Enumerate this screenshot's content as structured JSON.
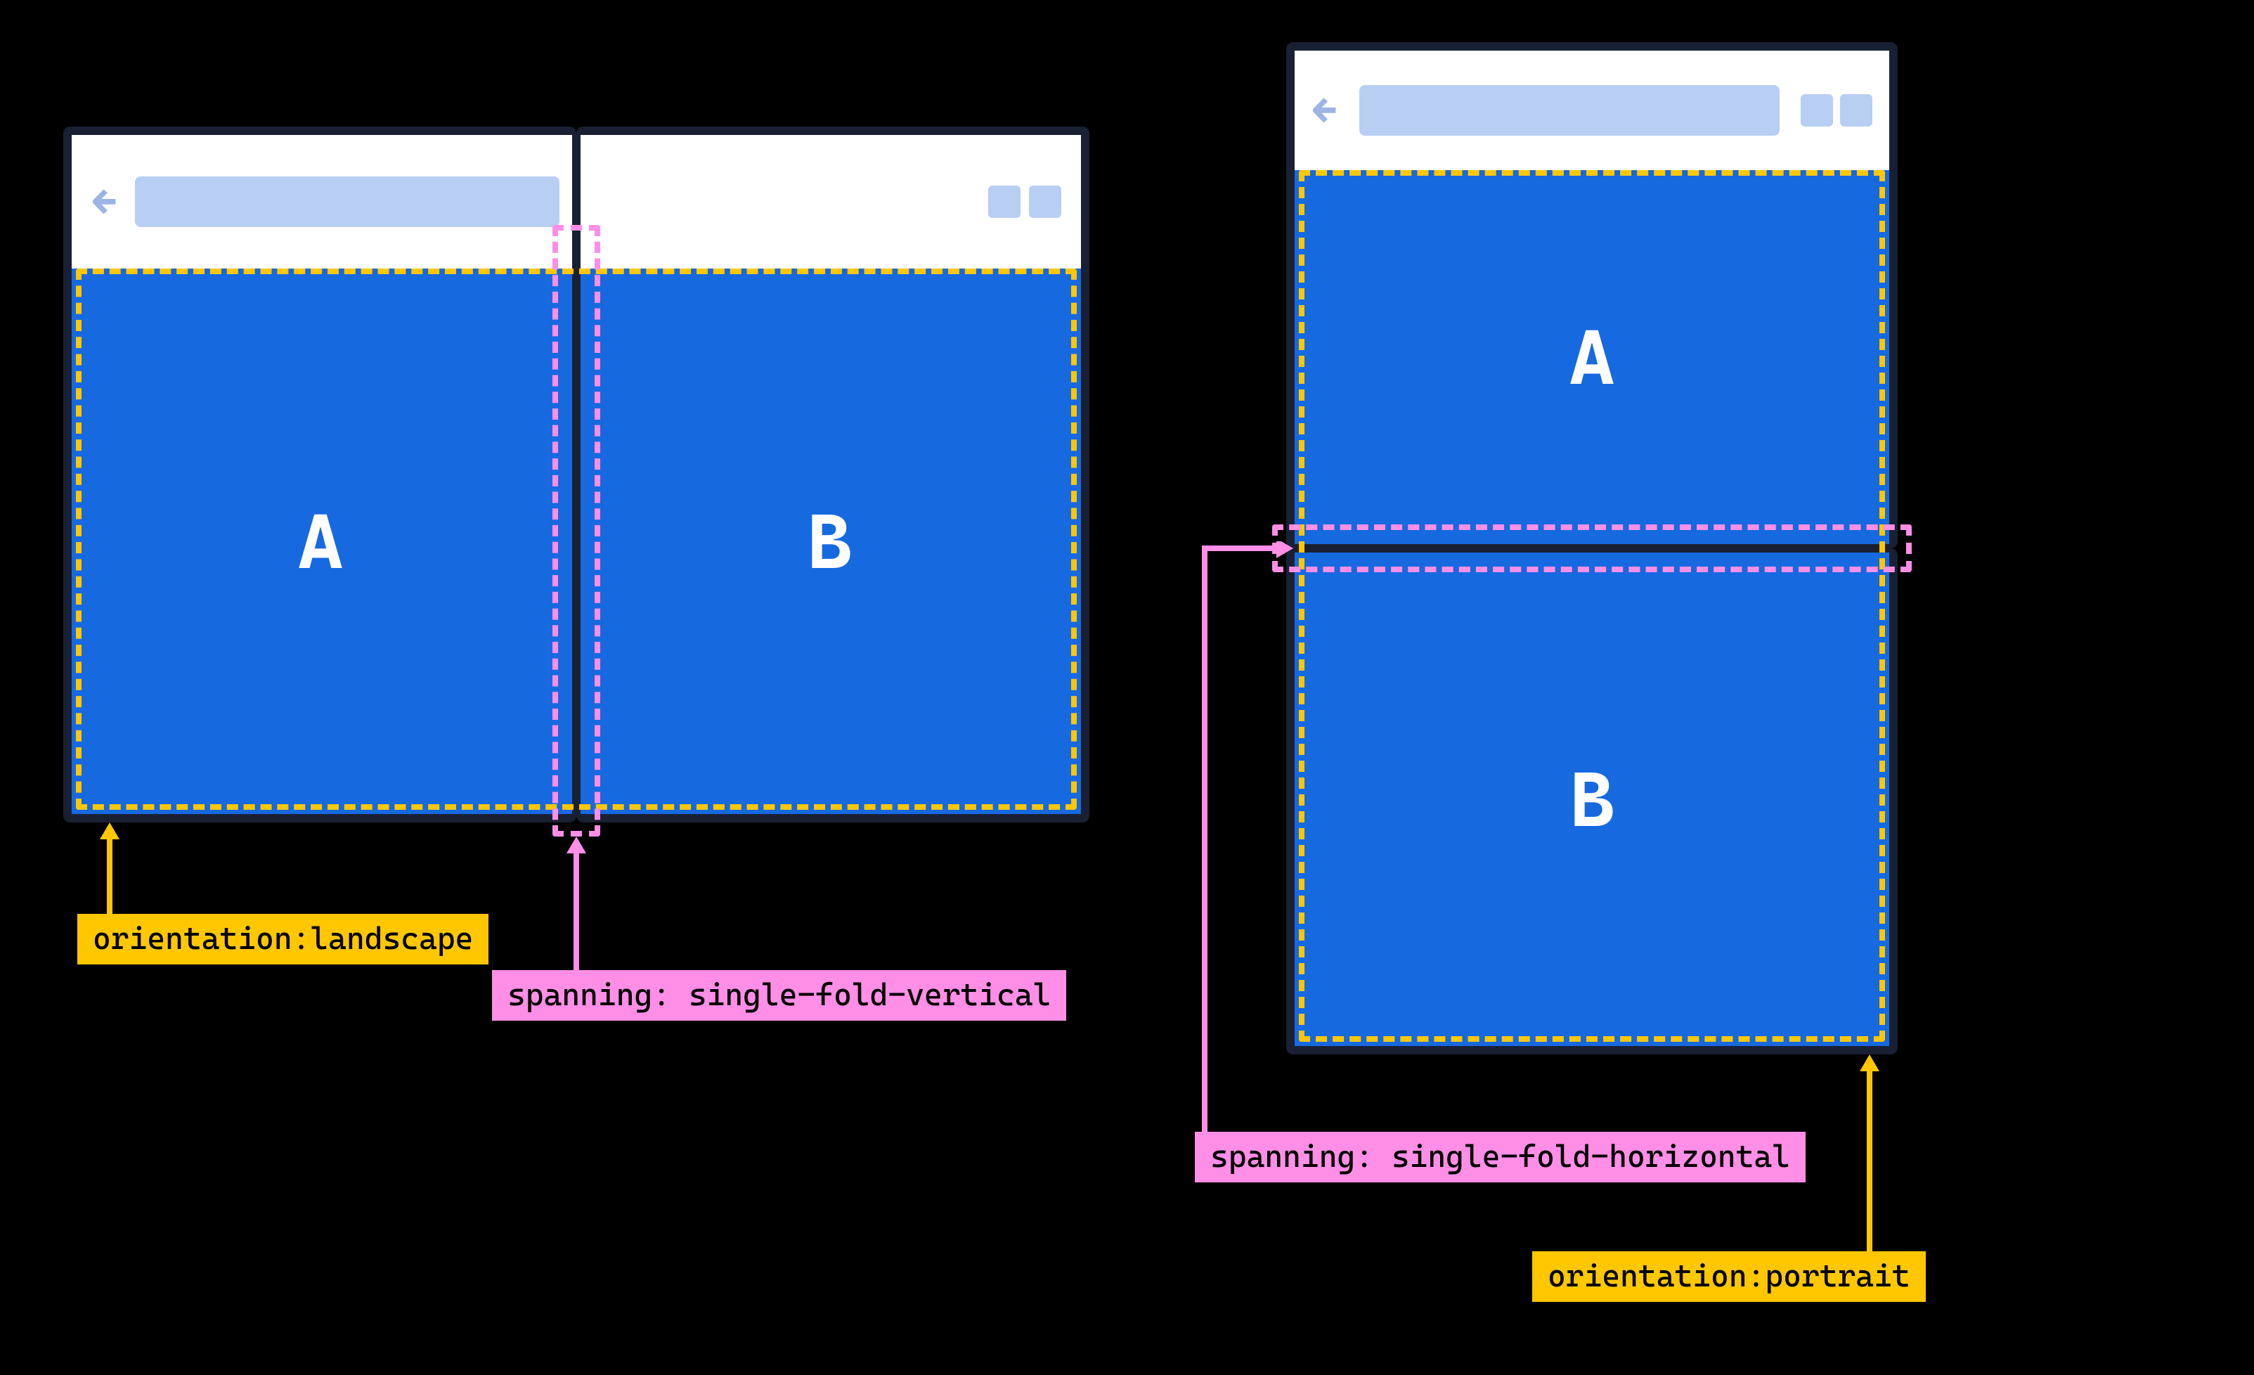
{
  "landscape": {
    "pane_a": "A",
    "pane_b": "B",
    "orientation_label": "orientation:landscape",
    "spanning_label": "spanning: single-fold-vertical"
  },
  "portrait": {
    "pane_a": "A",
    "pane_b": "B",
    "orientation_label": "orientation:portrait",
    "spanning_label": "spanning: single-fold-horizontal"
  },
  "colors": {
    "device_border": "#1a2033",
    "pane_fill": "#1769e0",
    "viewport_dash": "#ffc700",
    "fold_dash": "#ff8ee6",
    "addr_bar": "#b8cef3"
  }
}
